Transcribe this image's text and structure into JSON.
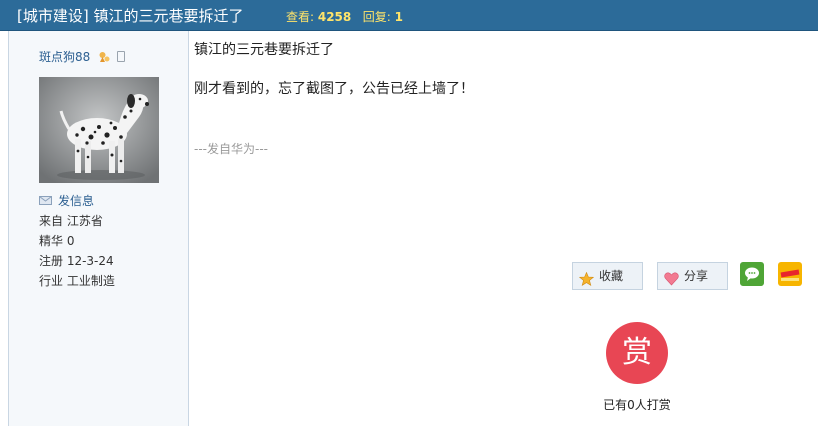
{
  "thread": {
    "title": "[城市建设] 镇江的三元巷要拆迁了",
    "stats_views_label": "查看: ",
    "stats_views": "4258",
    "stats_replies_label": "回复: ",
    "stats_replies": "1"
  },
  "author": {
    "name": "斑点狗88",
    "medal_icon": "medal-icon",
    "mobile_icon": "phone-icon",
    "avatar_icon": "dalmatian-dog-photo",
    "send_message": "发信息",
    "location": "来自 江苏省",
    "digest": "精华 0",
    "registered": "注册 12-3-24",
    "industry": "行业 工业制造"
  },
  "post": {
    "title": "镇江的三元巷要拆迁了",
    "body": "刚才看到的，忘了截图了，公告已经上墙了！",
    "signature": "---发自华为---"
  },
  "actions": {
    "favorite_label": "收藏",
    "share_label": "分享",
    "wechat_icon": "wechat-icon",
    "myqq_icon": "myqq-icon"
  },
  "reward": {
    "icon_text": "赏",
    "count_text": "已有0人打赏"
  },
  "colors": {
    "header_bg": "#2c6b99",
    "stats_text": "#ffe46a",
    "link": "#2c5f91",
    "reward": "#e84654"
  }
}
